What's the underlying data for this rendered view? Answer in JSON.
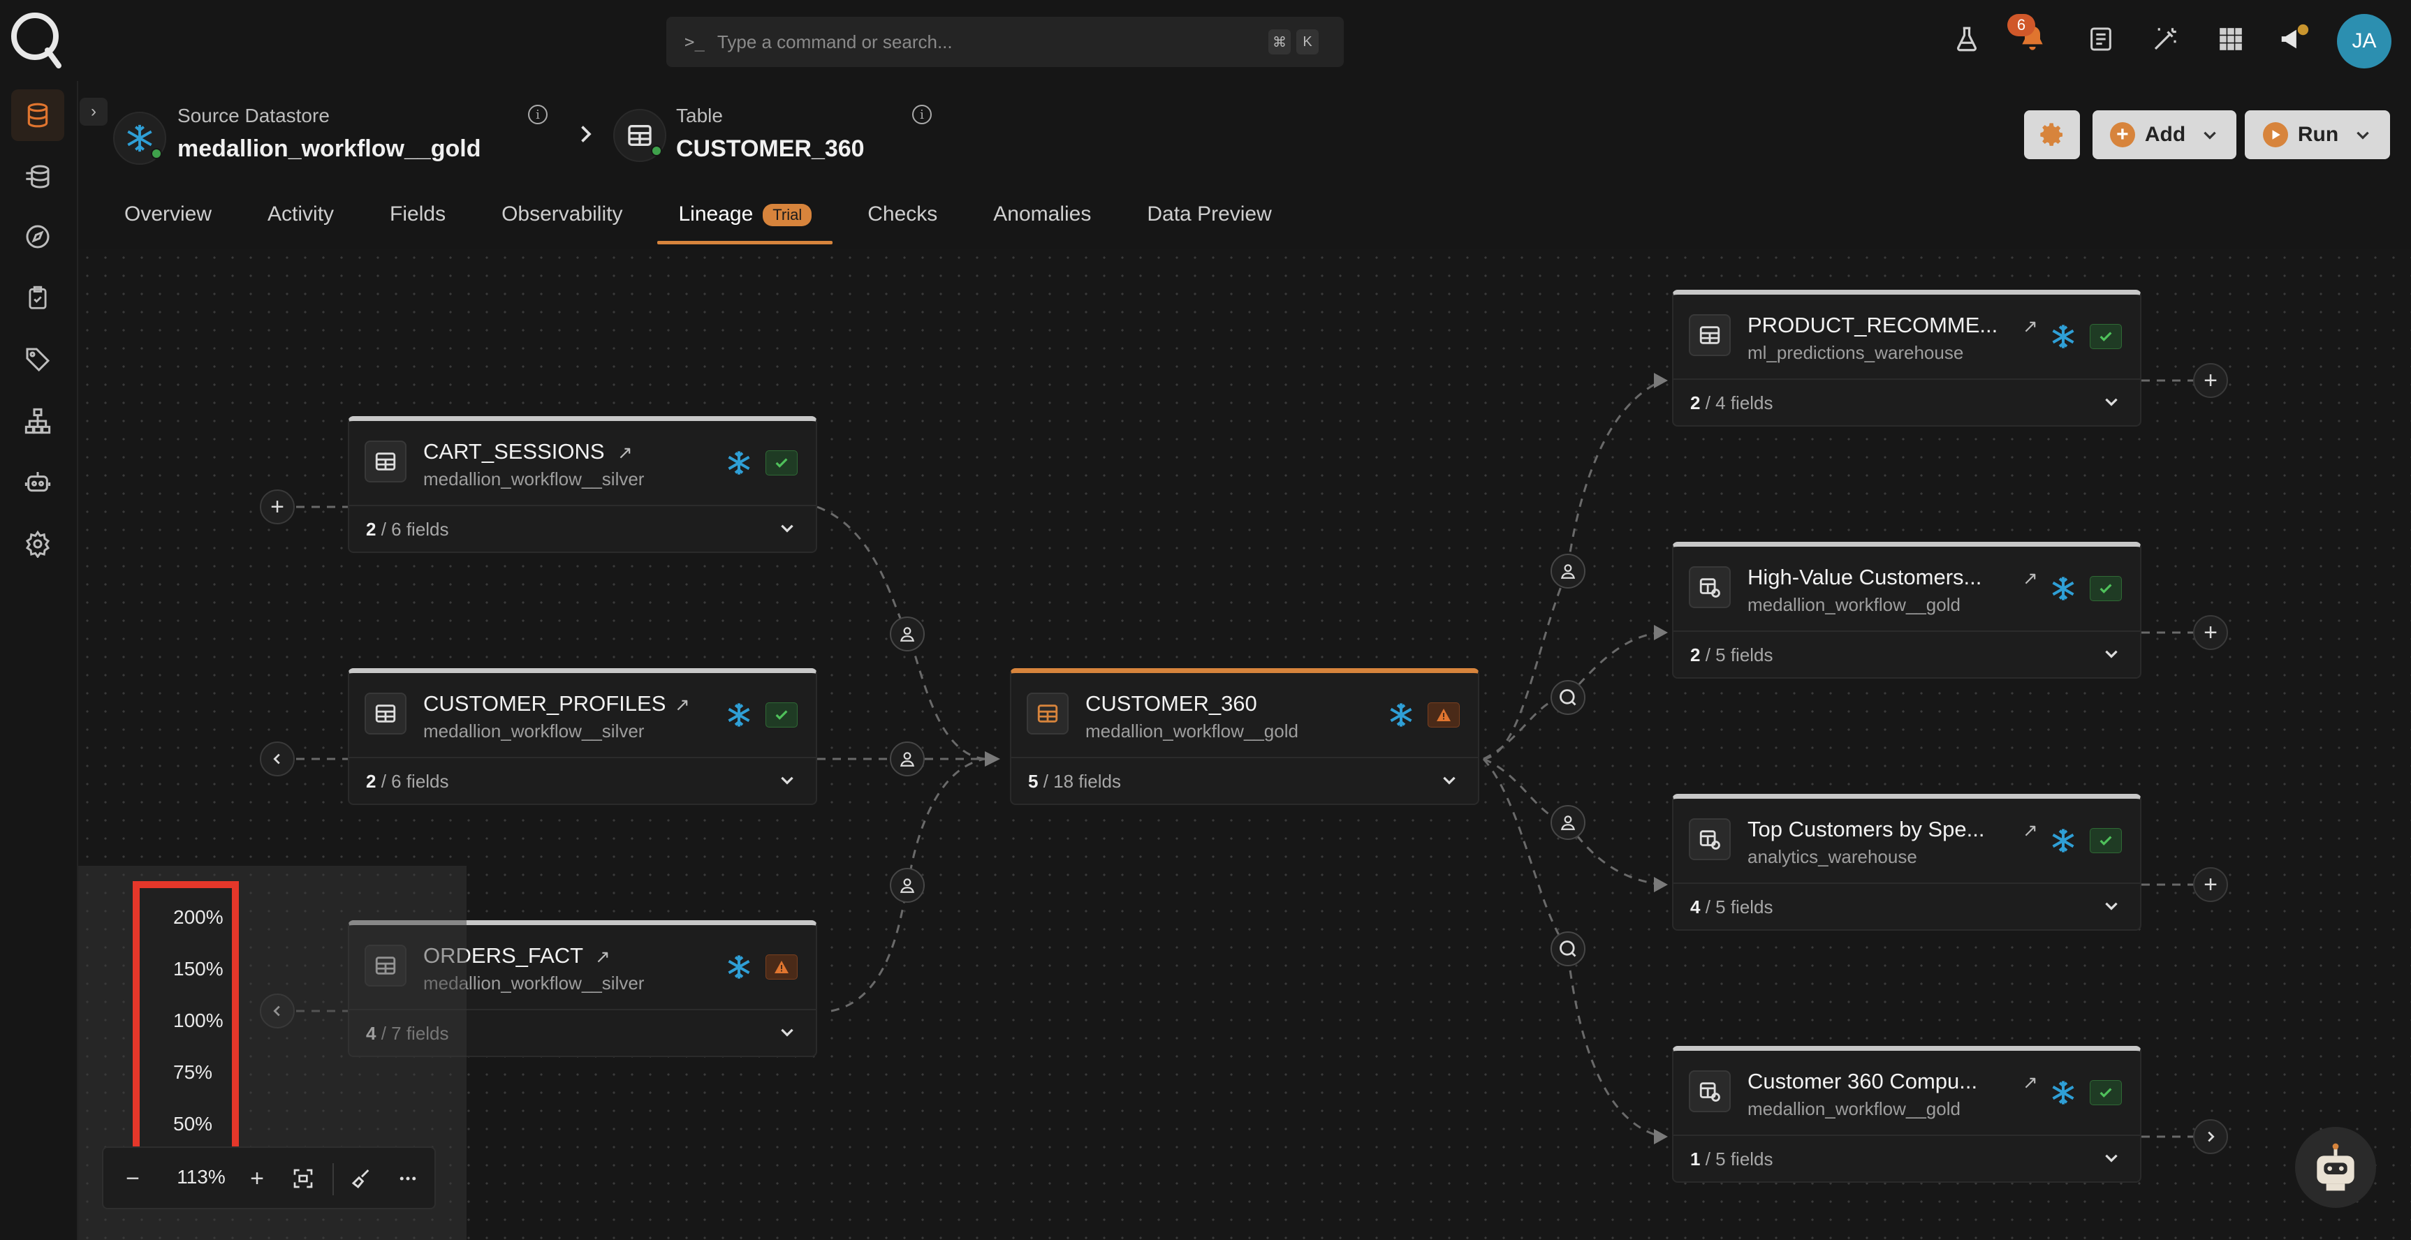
{
  "search": {
    "prompt": ">_",
    "placeholder": "Type a command or search...",
    "shortcut_keys": [
      "⌘",
      "K"
    ]
  },
  "topbar": {
    "icons": [
      "flask-icon",
      "bell-icon",
      "document-icon",
      "wand-icon",
      "grid-icon",
      "megaphone-icon"
    ],
    "notification_count": "6",
    "avatar_initials": "JA"
  },
  "sidebar": {
    "items": [
      "datastore-icon",
      "sources-icon",
      "explore-icon",
      "checks-icon",
      "tags-icon",
      "hierarchy-icon",
      "agent-icon",
      "settings-icon"
    ]
  },
  "breadcrumb": {
    "source_label": "Source Datastore",
    "source_value": "medallion_workflow__gold",
    "table_label": "Table",
    "table_value": "CUSTOMER_360"
  },
  "header_actions": {
    "add_label": "Add",
    "run_label": "Run"
  },
  "tabs": [
    {
      "label": "Overview"
    },
    {
      "label": "Activity"
    },
    {
      "label": "Fields"
    },
    {
      "label": "Observability"
    },
    {
      "label": "Lineage",
      "badge": "Trial",
      "active": true
    },
    {
      "label": "Checks"
    },
    {
      "label": "Anomalies"
    },
    {
      "label": "Data Preview"
    }
  ],
  "nodes": {
    "cart_sessions": {
      "name": "CART_SESSIONS",
      "sub": "medallion_workflow__silver",
      "count": "2",
      "total": " / 6 fields",
      "status": "ok"
    },
    "customer_profiles": {
      "name": "CUSTOMER_PROFILES",
      "sub": "medallion_workflow__silver",
      "count": "2",
      "total": " / 6 fields",
      "status": "ok"
    },
    "orders_fact": {
      "name": "ORDERS_FACT",
      "sub": "medallion_workflow__silver",
      "count": "4",
      "total": " / 7 fields",
      "status": "warn"
    },
    "customer_360": {
      "name": "CUSTOMER_360",
      "sub": "medallion_workflow__gold",
      "count": "5",
      "total": " / 18 fields",
      "status": "warn"
    },
    "product_recommend": {
      "name": "PRODUCT_RECOMME...",
      "sub": "ml_predictions_warehouse",
      "count": "2",
      "total": " / 4 fields",
      "status": "ok"
    },
    "high_value": {
      "name": "High-Value Customers...",
      "sub": "medallion_workflow__gold",
      "count": "2",
      "total": " / 5 fields",
      "status": "ok"
    },
    "top_customers": {
      "name": "Top Customers by Spe...",
      "sub": "analytics_warehouse",
      "count": "4",
      "total": " / 5 fields",
      "status": "ok"
    },
    "customer_360_compute": {
      "name": "Customer 360 Compu...",
      "sub": "medallion_workflow__gold",
      "count": "1",
      "total": " / 5 fields",
      "status": "ok"
    }
  },
  "zoom": {
    "options": [
      "200%",
      "150%",
      "100%",
      "75%",
      "50%"
    ],
    "level": "113%"
  },
  "colors": {
    "accent": "#d7843c",
    "highlight": "#e5372a",
    "ok": "#3fa14b",
    "snowflake": "#2f9fd6"
  }
}
